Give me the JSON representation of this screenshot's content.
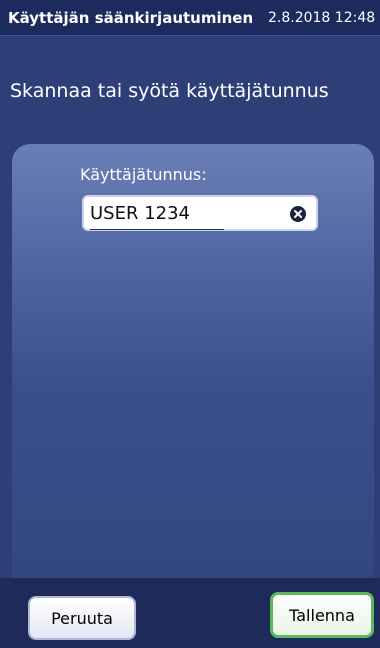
{
  "header": {
    "title": "Käyttäjän säänkirjautuminen",
    "datetime": "2.8.2018 12:48"
  },
  "prompt": "Skannaa tai syötä käyttäjätunnus",
  "form": {
    "username_label": "Käyttäjätunnus:",
    "username_value": "USER 1234"
  },
  "buttons": {
    "cancel_label": "Peruuta",
    "save_label": "Tallenna"
  },
  "icons": {
    "clear": "clear-icon"
  },
  "colors": {
    "background": "#2e3f78",
    "titlebar": "#1c2a5e",
    "save_border": "#5cb85c"
  }
}
